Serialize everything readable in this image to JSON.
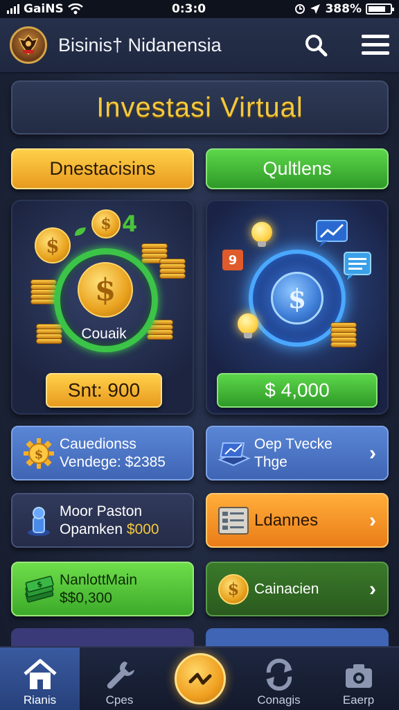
{
  "status_bar": {
    "carrier": "GaiNS",
    "time": "0:3:0",
    "battery": "388%"
  },
  "header": {
    "app_name": "Bisinis† Nidanensia",
    "logo_icon": "emblem-logo",
    "search_icon": "search-icon",
    "menu_icon": "hamburger-menu-icon"
  },
  "banner": {
    "title": "Investasi Virtual"
  },
  "tabs": [
    {
      "label": "Dnestacisins",
      "color": "#f0b22e"
    },
    {
      "label": "Qultlens",
      "color": "#45b836"
    }
  ],
  "cards": [
    {
      "ring_label": "Couaik",
      "value": "Snt: 900"
    },
    {
      "value": "$ 4,000",
      "badge": "9"
    }
  ],
  "tiles": [
    {
      "line1": "Cauedionss",
      "line2": "Vendege: $2385",
      "icon": "gear-coin-icon"
    },
    {
      "line1": "Oep Tvecke",
      "line2": "Thge",
      "icon": "chart-board-icon"
    },
    {
      "line1": "Moor Paston",
      "line2_prefix": "Opamken ",
      "line2_value": "$000",
      "icon": "figure-icon"
    },
    {
      "line1": "Ldannes",
      "icon": "ledger-icon"
    },
    {
      "line1": "NanlottMain",
      "line2": "$$0,300",
      "icon": "money-stack-icon"
    },
    {
      "line1": "Cainacien",
      "icon": "dollar-coin-icon"
    }
  ],
  "bottom_nav": [
    {
      "label": "Rianis",
      "icon": "home-icon",
      "active": true
    },
    {
      "label": "Cpes",
      "icon": "wrench-icon",
      "active": false
    },
    {
      "label": "",
      "icon": "trend-coin-icon",
      "active": false
    },
    {
      "label": "Conagis",
      "icon": "exchange-icon",
      "active": false
    },
    {
      "label": "Eaerp",
      "icon": "camera-icon",
      "active": false
    }
  ]
}
